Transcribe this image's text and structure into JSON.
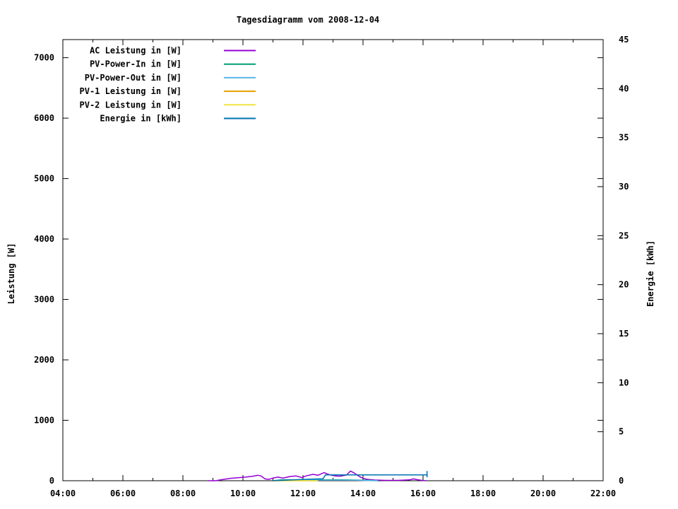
{
  "title": "Tagesdiagramm vom 2008-12-04",
  "chart_data": {
    "type": "line",
    "title": "Tagesdiagramm vom 2008-12-04",
    "xlabel": "",
    "ylabel": "Leistung [W]",
    "y2label": "Energie [kWh]",
    "xlim": [
      "04:00",
      "22:00"
    ],
    "ylim": [
      0,
      7300
    ],
    "y2lim": [
      0,
      45
    ],
    "grid": false,
    "legend_position": "top-left-inside",
    "x_ticks": [
      "04:00",
      "06:00",
      "08:00",
      "10:00",
      "12:00",
      "14:00",
      "16:00",
      "18:00",
      "20:00",
      "22:00"
    ],
    "x_minor_tick_interval_minutes": 60,
    "y_ticks": [
      "0",
      "1000",
      "2000",
      "3000",
      "4000",
      "5000",
      "6000",
      "7000"
    ],
    "y2_ticks": [
      "0",
      "5",
      "10",
      "15",
      "20",
      "25",
      "30",
      "35",
      "40",
      "45"
    ],
    "series": [
      {
        "name": "AC Leistung in [W]",
        "color": "#9400d3",
        "yaxis": "y1",
        "points": [
          [
            "08:50",
            0
          ],
          [
            "09:05",
            0
          ],
          [
            "09:20",
            20
          ],
          [
            "09:35",
            40
          ],
          [
            "09:50",
            50
          ],
          [
            "10:05",
            60
          ],
          [
            "10:20",
            75
          ],
          [
            "10:30",
            90
          ],
          [
            "10:36",
            80
          ],
          [
            "10:44",
            30
          ],
          [
            "10:52",
            22
          ],
          [
            "11:00",
            45
          ],
          [
            "11:10",
            60
          ],
          [
            "11:20",
            42
          ],
          [
            "11:34",
            70
          ],
          [
            "11:46",
            80
          ],
          [
            "11:58",
            52
          ],
          [
            "12:06",
            80
          ],
          [
            "12:20",
            105
          ],
          [
            "12:30",
            90
          ],
          [
            "12:42",
            135
          ],
          [
            "12:48",
            115
          ],
          [
            "12:55",
            95
          ],
          [
            "13:04",
            80
          ],
          [
            "13:14",
            75
          ],
          [
            "13:27",
            95
          ],
          [
            "13:35",
            160
          ],
          [
            "13:42",
            130
          ],
          [
            "13:49",
            90
          ],
          [
            "13:56",
            55
          ],
          [
            "14:03",
            32
          ],
          [
            "14:10",
            22
          ],
          [
            "14:24",
            12
          ],
          [
            "14:45",
            6
          ],
          [
            "15:10",
            6
          ],
          [
            "15:33",
            14
          ],
          [
            "15:41",
            30
          ],
          [
            "15:48",
            18
          ],
          [
            "15:58",
            6
          ],
          [
            "16:06",
            0
          ]
        ]
      },
      {
        "name": "PV-Power-In in [W]",
        "color": "#009e73",
        "yaxis": "y1",
        "points": [
          [
            "11:00",
            0
          ],
          [
            "11:15",
            14
          ],
          [
            "11:45",
            16
          ],
          [
            "12:15",
            18
          ],
          [
            "12:45",
            16
          ],
          [
            "13:15",
            16
          ],
          [
            "13:45",
            12
          ],
          [
            "14:10",
            8
          ],
          [
            "14:30",
            0
          ]
        ]
      },
      {
        "name": "PV-Power-Out in [W]",
        "color": "#56b4e9",
        "yaxis": "y1",
        "points": [
          [
            "11:00",
            0
          ],
          [
            "11:15",
            8
          ],
          [
            "11:45",
            10
          ],
          [
            "12:15",
            12
          ],
          [
            "12:45",
            10
          ],
          [
            "13:15",
            10
          ],
          [
            "13:45",
            8
          ],
          [
            "14:10",
            4
          ],
          [
            "14:30",
            0
          ]
        ]
      },
      {
        "name": "PV-1 Leistung in [W]",
        "color": "#e69f00",
        "yaxis": "y1",
        "points": [
          [
            "11:00",
            0
          ],
          [
            "12:30",
            0
          ]
        ]
      },
      {
        "name": "PV-2 Leistung in [W]",
        "color": "#f0e442",
        "yaxis": "y1",
        "points": [
          [
            "11:00",
            0
          ],
          [
            "12:30",
            0
          ]
        ]
      },
      {
        "name": "Energie in [kWh]",
        "color": "#0072b2",
        "yaxis": "y2",
        "points": [
          [
            "11:00",
            0
          ],
          [
            "11:45",
            0.1
          ],
          [
            "12:10",
            0.15
          ],
          [
            "12:40",
            0.2
          ],
          [
            "12:45",
            0.6
          ],
          [
            "16:08",
            0.6
          ],
          [
            "16:08",
            0.95
          ],
          [
            "16:08",
            0.35
          ]
        ]
      }
    ]
  }
}
